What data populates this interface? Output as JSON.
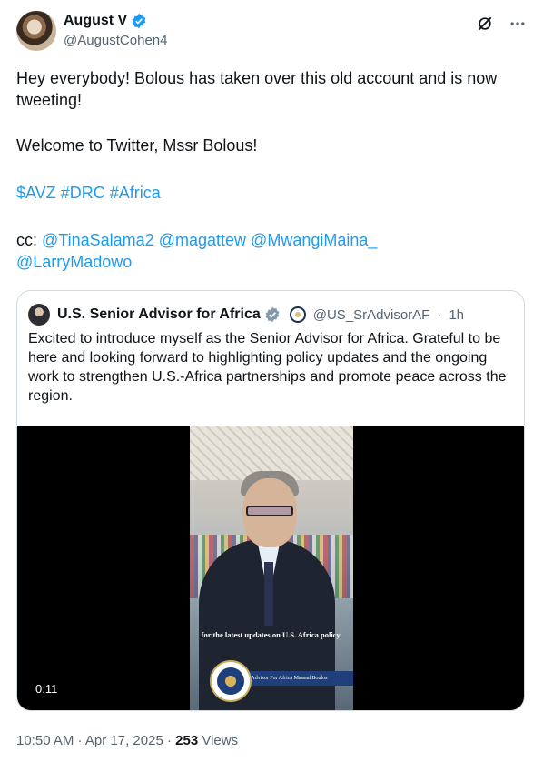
{
  "author": {
    "name": "August V",
    "handle": "@AugustCohen4"
  },
  "top_icons": [
    "grok-icon",
    "more-icon"
  ],
  "tweet": {
    "line1": "Hey everybody! Bolous has taken over this old account and is now tweeting!",
    "line2": "Welcome to Twitter, Mssr Bolous!",
    "hashtags": [
      "$AVZ",
      "#DRC",
      "#Africa"
    ],
    "cc_label": "cc:",
    "mentions": [
      "@TinaSalama2",
      "@magattew",
      "@MwangiMaina_",
      "@LarryMadowo"
    ]
  },
  "quote": {
    "name": "U.S. Senior Advisor for Africa",
    "handle": "@US_SrAdvisorAF",
    "separator": "·",
    "time": "1h",
    "text": "Excited to introduce myself as the Senior Advisor for Africa. Grateful to be here and looking forward to highlighting policy updates and the ongoing work to strengthen U.S.-Africa partnerships and promote peace across the region.",
    "video": {
      "caption": "for the latest updates on U.S. Africa policy.",
      "banner": "Senior Advisor For Africa Massad Boulos",
      "duration": "0:11"
    }
  },
  "meta": {
    "time": "10:50 AM",
    "separator": " · ",
    "date": "Apr 17, 2025",
    "views_count": "253",
    "views_label": "Views"
  },
  "colors": {
    "link": "#1d9bf0",
    "secondary_text": "#536471",
    "border": "#cfd9de",
    "verified_blue": "#1d9bf0",
    "verified_gray": "#829aab"
  }
}
